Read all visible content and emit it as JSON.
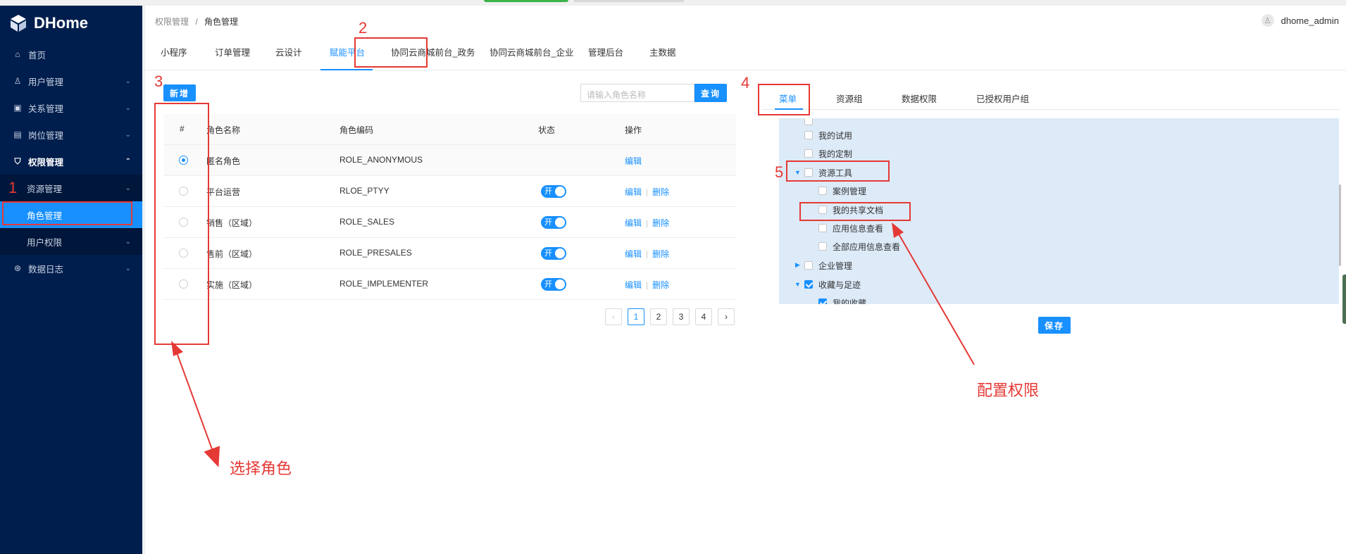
{
  "sidebar": {
    "brand": "DHome",
    "items": [
      {
        "label": "首页",
        "icon": "home-icon"
      },
      {
        "label": "用户管理",
        "icon": "user-icon"
      },
      {
        "label": "关系管理",
        "icon": "relation-icon"
      },
      {
        "label": "岗位管理",
        "icon": "post-icon"
      },
      {
        "label": "权限管理",
        "icon": "shield-icon"
      },
      {
        "label": "资源管理"
      },
      {
        "label": "角色管理"
      },
      {
        "label": "用户权限"
      },
      {
        "label": "数据日志",
        "icon": "log-icon"
      }
    ]
  },
  "header": {
    "breadcrumb_parent": "权限管理",
    "breadcrumb_sep": "/",
    "breadcrumb_current": "角色管理",
    "username": "dhome_admin"
  },
  "tabs": [
    "小程序",
    "订单管理",
    "云设计",
    "赋能平台",
    "协同云商城前台_政务",
    "协同云商城前台_企业",
    "管理后台",
    "主数据"
  ],
  "active_tab": "赋能平台",
  "left": {
    "new_button": "新增",
    "search_placeholder": "请输入角色名称",
    "query_button": "查询",
    "columns": [
      "#",
      "角色名称",
      "角色编码",
      "状态",
      "操作"
    ],
    "rows": [
      {
        "name": "匿名角色",
        "code": "ROLE_ANONYMOUS",
        "status": "",
        "edit": "编辑",
        "delete": ""
      },
      {
        "name": "平台运营",
        "code": "RLOE_PTYY",
        "status": "开",
        "edit": "编辑",
        "delete": "删除"
      },
      {
        "name": "销售（区域）",
        "code": "ROLE_SALES",
        "status": "开",
        "edit": "编辑",
        "delete": "删除"
      },
      {
        "name": "售前（区域）",
        "code": "ROLE_PRESALES",
        "status": "开",
        "edit": "编辑",
        "delete": "删除"
      },
      {
        "name": "实施（区域）",
        "code": "ROLE_IMPLEMENTER",
        "status": "开",
        "edit": "编辑",
        "delete": "删除"
      }
    ],
    "pages": [
      "1",
      "2",
      "3",
      "4"
    ],
    "current_page": "1"
  },
  "right": {
    "tabs": [
      "菜单",
      "资源组",
      "数据权限",
      "已授权用户组"
    ],
    "active_tab": "菜单",
    "tree": [
      {
        "label": "我的试用",
        "checked": false
      },
      {
        "label": "我的定制",
        "checked": false
      },
      {
        "label": "资源工具",
        "checked": false
      },
      {
        "label": "案例管理",
        "checked": false
      },
      {
        "label": "我的共享文档",
        "checked": false
      },
      {
        "label": "应用信息查看",
        "checked": false
      },
      {
        "label": "全部应用信息查看",
        "checked": false
      },
      {
        "label": "企业管理",
        "checked": false
      },
      {
        "label": "收藏与足迹",
        "checked": true
      },
      {
        "label": "我的收藏",
        "checked": true
      }
    ],
    "save_button": "保存"
  },
  "annotations": {
    "n1": "1",
    "n2": "2",
    "n3": "3",
    "n4": "4",
    "n5": "5",
    "select_role": "选择角色",
    "config_perm": "配置权限",
    "color": "#e53935"
  }
}
